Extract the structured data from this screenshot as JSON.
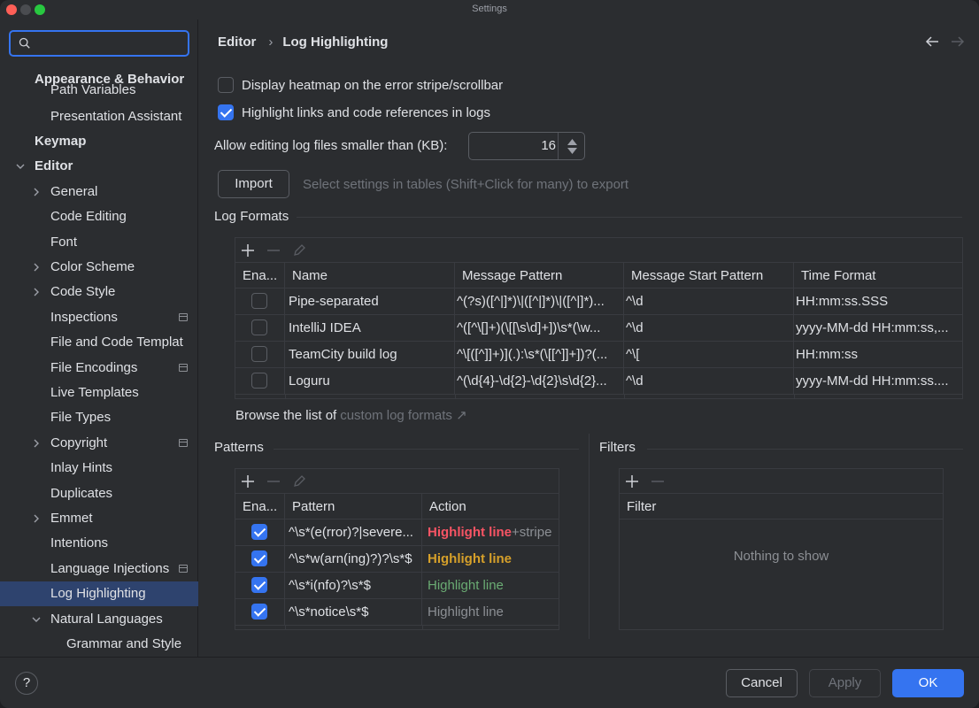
{
  "window": {
    "title": "Settings"
  },
  "search": {
    "value": "",
    "placeholder": ""
  },
  "sidebar": {
    "items": [
      {
        "label": "Appearance & Behavior"
      },
      {
        "label": "Path Variables"
      },
      {
        "label": "Presentation Assistant"
      },
      {
        "label": "Keymap"
      },
      {
        "label": "Editor"
      },
      {
        "label": "General"
      },
      {
        "label": "Code Editing"
      },
      {
        "label": "Font"
      },
      {
        "label": "Color Scheme"
      },
      {
        "label": "Code Style"
      },
      {
        "label": "Inspections"
      },
      {
        "label": "File and Code Templat"
      },
      {
        "label": "File Encodings"
      },
      {
        "label": "Live Templates"
      },
      {
        "label": "File Types"
      },
      {
        "label": "Copyright"
      },
      {
        "label": "Inlay Hints"
      },
      {
        "label": "Duplicates"
      },
      {
        "label": "Emmet"
      },
      {
        "label": "Intentions"
      },
      {
        "label": "Language Injections"
      },
      {
        "label": "Log Highlighting"
      },
      {
        "label": "Natural Languages"
      },
      {
        "label": "Grammar and Style"
      }
    ]
  },
  "breadcrumb": {
    "parent": "Editor",
    "current": "Log Highlighting"
  },
  "options": {
    "heatmap_label": "Display heatmap on the error stripe/scrollbar",
    "highlight_links_label": "Highlight links and code references in logs",
    "allow_editing_label": "Allow editing log files smaller than (KB):",
    "allow_editing_value": "16"
  },
  "import": {
    "label": "Import",
    "hint": "Select settings in tables (Shift+Click for many) to export"
  },
  "log_formats": {
    "title": "Log Formats",
    "columns": [
      "Ena...",
      "Name",
      "Message Pattern",
      "Message Start Pattern",
      "Time Format"
    ],
    "rows": [
      {
        "name": "Pipe-separated",
        "pattern": "^(?s)([^|]*)\\|([^|]*)\\|([^|]*)...",
        "start": "^\\d",
        "time": "HH:mm:ss.SSS"
      },
      {
        "name": "IntelliJ IDEA",
        "pattern": "^([^\\[]+)(\\[[\\s\\d]+])\\s*(\\w...",
        "start": "^\\d",
        "time": "yyyy-MM-dd HH:mm:ss,..."
      },
      {
        "name": "TeamCity build log",
        "pattern": "^\\[([^]]+)](.):\\s*(\\[[^]]+])?(...",
        "start": "^\\[",
        "time": "HH:mm:ss"
      },
      {
        "name": "Loguru",
        "pattern": "^(\\d{4}-\\d{2}-\\d{2}\\s\\d{2}...",
        "start": "^\\d",
        "time": "yyyy-MM-dd HH:mm:ss...."
      }
    ],
    "browse_text": "Browse the list of",
    "browse_link": "custom log formats ↗"
  },
  "patterns": {
    "title": "Patterns",
    "columns": [
      "Ena...",
      "Pattern",
      "Action"
    ],
    "rows": [
      {
        "pattern": "^\\s*(e(rror)?|severe...",
        "action": "Highlight line",
        "extra": "+stripe"
      },
      {
        "pattern": "^\\s*w(arn(ing)?)?\\s*$",
        "action": "Highlight line",
        "extra": ""
      },
      {
        "pattern": "^\\s*i(nfo)?\\s*$",
        "action": "Highlight line",
        "extra": ""
      },
      {
        "pattern": "^\\s*notice\\s*$",
        "action": "Highlight line",
        "extra": ""
      }
    ]
  },
  "filters": {
    "title": "Filters",
    "column": "Filter",
    "empty": "Nothing to show"
  },
  "footer": {
    "help": "?",
    "cancel": "Cancel",
    "apply": "Apply",
    "ok": "OK"
  },
  "colors": {
    "accent": "#3574f0",
    "error": "#f75464",
    "warning": "#d6a02a",
    "info": "#6aab73"
  }
}
